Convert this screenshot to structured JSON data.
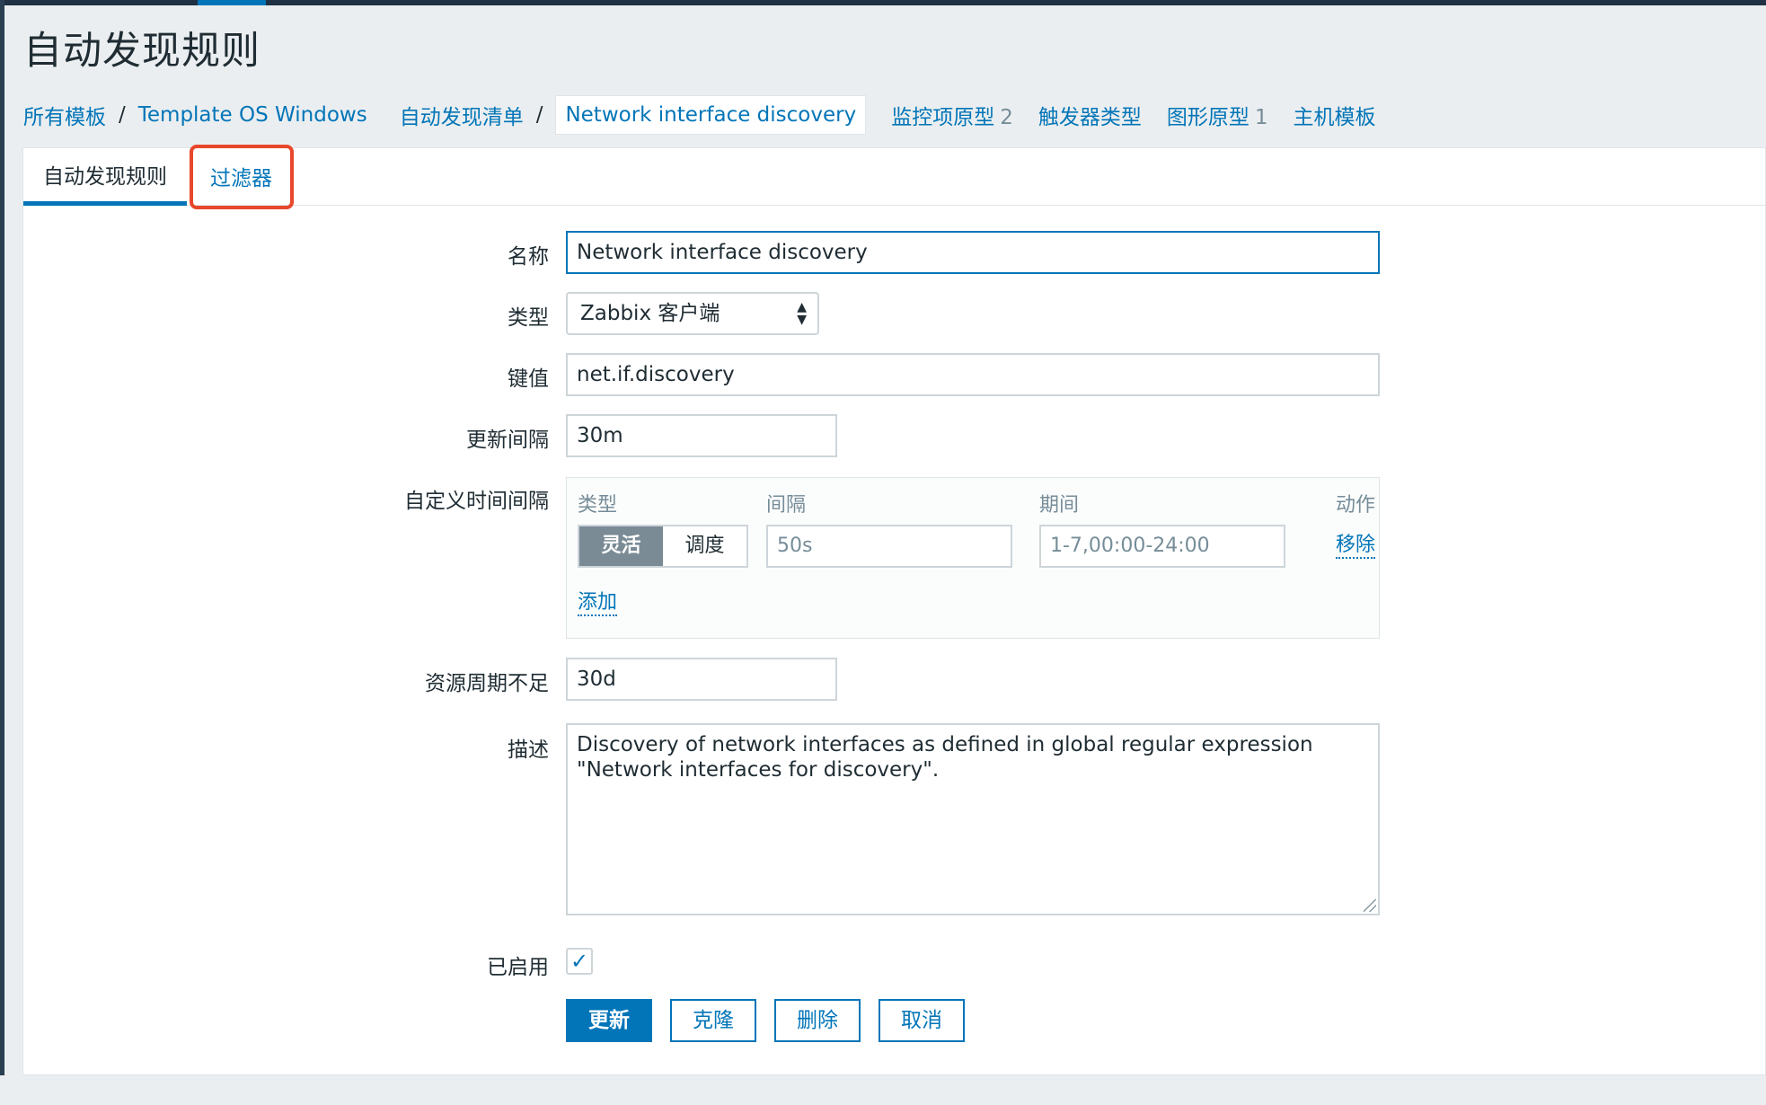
{
  "page": {
    "title": "自动发现规则"
  },
  "breadcrumb": {
    "items": [
      "所有模板",
      "Template OS Windows",
      "自动发现清单"
    ],
    "separator": "/",
    "current": "Network interface discovery"
  },
  "nav": [
    {
      "label": "监控项原型",
      "count": "2"
    },
    {
      "label": "触发器类型",
      "count": ""
    },
    {
      "label": "图形原型",
      "count": "1"
    },
    {
      "label": "主机模板",
      "count": ""
    }
  ],
  "tabs": {
    "active": "自动发现规则",
    "filter": "过滤器"
  },
  "form": {
    "name_label": "名称",
    "name_value": "Network interface discovery",
    "type_label": "类型",
    "type_value": "Zabbix 客户端",
    "key_label": "键值",
    "key_value": "net.if.discovery",
    "interval_label": "更新间隔",
    "interval_value": "30m",
    "custom_label": "自定义时间间隔",
    "custom": {
      "col_type": "类型",
      "col_interval": "间隔",
      "col_period": "期间",
      "col_action": "动作",
      "flexible": "灵活",
      "scheduling": "调度",
      "interval": "50s",
      "period": "1-7,00:00-24:00",
      "remove": "移除",
      "add": "添加"
    },
    "lifetime_label": "资源周期不足",
    "lifetime_value": "30d",
    "desc_label": "描述",
    "desc_value": "Discovery of network interfaces as defined in global regular expression \"Network interfaces for discovery\".",
    "enabled_label": "已启用",
    "enabled": true
  },
  "buttons": {
    "update": "更新",
    "clone": "克隆",
    "delete": "删除",
    "cancel": "取消"
  },
  "colors": {
    "accent": "#0275b8",
    "highlight": "#e8472b"
  }
}
